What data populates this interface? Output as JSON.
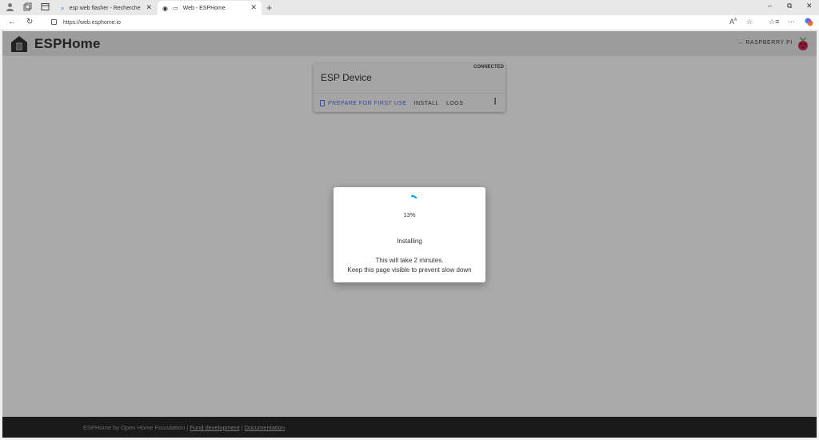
{
  "browser": {
    "tabs": [
      {
        "title": "esp web flasher - Recherche"
      },
      {
        "title": "Web - ESPHome"
      }
    ],
    "new_tab": "+",
    "url": "https://web.esphome.io"
  },
  "app": {
    "brand": "ESPHome",
    "board_label": "RASPBERRY PI",
    "arrow": "→"
  },
  "device_card": {
    "status": "CONNECTED",
    "title": "ESP Device",
    "actions": {
      "prepare": "PREPARE FOR FIRST USE",
      "install": "INSTALL",
      "logs": "LOGS"
    }
  },
  "dialog": {
    "progress_text": "13%",
    "progress": 0.13,
    "status": "Installing",
    "message_line1": "This will take 2 minutes.",
    "message_line2": "Keep this page visible to prevent slow down"
  },
  "footer": {
    "prefix": "ESPHome by Open Home Foundation |",
    "fund_link": "Fund development",
    "separator": "|",
    "docs_link": "Documentation"
  },
  "colors": {
    "overlay_bg": "#aaaaaa",
    "footer_bg": "#1a1a1a",
    "spinner": "#03a9f4",
    "primary_action": "#3d4aa0"
  }
}
